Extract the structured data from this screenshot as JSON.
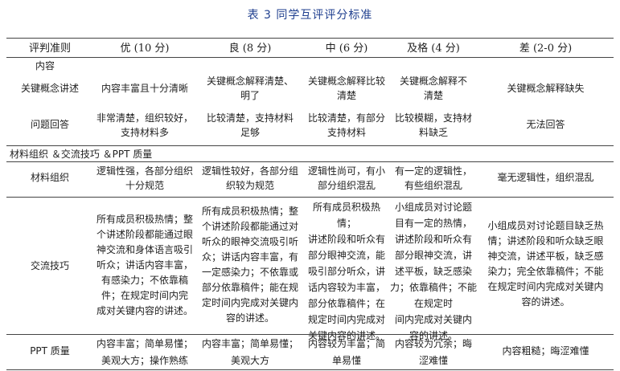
{
  "table": {
    "title": "表 3 同学互评评分标准",
    "headers": [
      "评判准则",
      "优 (10 分)",
      "良 (8 分)",
      "中 (6 分)",
      "及格 (4 分)",
      "差 (2-0 分)"
    ],
    "groups": [
      "内容",
      "材料组织 ＆交流技巧 ＆PPT 质量"
    ],
    "rows": [
      {
        "criterion": "关键概念讲述",
        "cells": [
          [
            "内容丰富且十分清晰"
          ],
          [
            "关键概念解释清楚、",
            "明了"
          ],
          [
            "关键概念解释比较",
            "清楚"
          ],
          [
            "关键概念解释不",
            "清楚"
          ],
          [
            "关键概念解释缺失"
          ]
        ]
      },
      {
        "criterion": "问题回答",
        "cells": [
          [
            "非常清楚，组织较好，",
            "支持材料多"
          ],
          [
            "比较清楚，支持材料",
            "足够"
          ],
          [
            "比较清楚，有部分",
            "支持材料"
          ],
          [
            "比较模糊，支持材",
            "料缺乏"
          ],
          [
            "无法回答"
          ]
        ]
      },
      {
        "criterion": "材料组织",
        "cells": [
          [
            "逻辑性强，各部分组织",
            "十分规范"
          ],
          [
            "逻辑性较好，各部分组",
            "织较为规范"
          ],
          [
            "逻辑性尚可，有小",
            "部分组织混乱"
          ],
          [
            "有一定的逻辑性，",
            "有些组织混乱"
          ],
          [
            "毫无逻辑性，组织混乱"
          ]
        ]
      },
      {
        "criterion": "交流技巧",
        "cells": [
          [
            "所有成员积极热情；整",
            "个讲述阶段都能通过眼",
            "神交流和身体语言吸引",
            "听众；讲话内容丰富，",
            "有感染力；不依靠稿",
            "件；在规定时间内完",
            "成对关键内容的讲述。"
          ],
          [
            "所有成员积极热情；整",
            "个讲述阶段都能通过对",
            "听众的眼神交流吸引听",
            "众；讲话内容丰富，有",
            "一定感染力；不依靠或",
            "部分依靠稿件；能在规",
            "定时间内完成对关键内",
            "容的讲述。"
          ],
          [
            "所有成员积极热情；",
            "讲述阶段和听众有",
            "部分眼神交流，能",
            "吸引部分听众，讲",
            "话内容较为丰富，",
            "部分依靠稿件；在",
            "规定时间内完成对",
            "关键内容的讲述。"
          ],
          [
            "小组成员对讨论题",
            "目有一定的热情，",
            "讲述阶段和听众有",
            "部分眼神交流，讲",
            "述平板，缺乏感染",
            "力；依靠稿件；不能在规定时",
            "间内完成对关键内",
            "容的讲述。"
          ],
          [
            "小组成员对讨论题目缺乏热",
            "情；讲述阶段和听众缺乏眼",
            "神交流，讲述平板，缺乏感",
            "染力；完全依靠稿件；不能",
            "在规定时间内完成对关键内",
            "容的讲述。"
          ]
        ]
      },
      {
        "criterion": "PPT 质量",
        "cells": [
          [
            "内容丰富；简单易懂；",
            "美观大方；操作熟练"
          ],
          [
            "内容丰富；简单易懂；",
            "美观大方"
          ],
          [
            "内容较为丰富；简",
            "单易懂"
          ],
          [
            "内容较为冗余；晦",
            "涩难懂"
          ],
          [
            "内容粗糙；晦涩难懂"
          ]
        ]
      }
    ]
  }
}
